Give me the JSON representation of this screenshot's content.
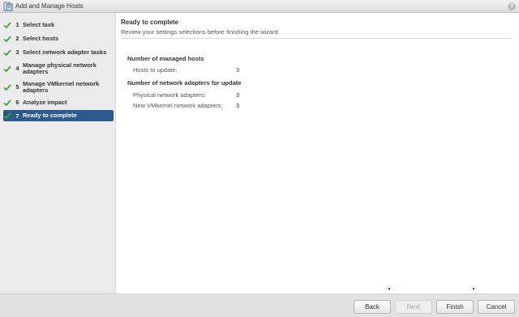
{
  "window": {
    "title": "Add and Manage Hosts",
    "help_glyph": "?"
  },
  "steps": [
    {
      "num": "1",
      "label": "Select task",
      "done": true,
      "active": false
    },
    {
      "num": "2",
      "label": "Select hosts",
      "done": true,
      "active": false
    },
    {
      "num": "3",
      "label": "Select network adapter tasks",
      "done": true,
      "active": false
    },
    {
      "num": "4",
      "label": "Manage physical network adapters",
      "done": true,
      "active": false
    },
    {
      "num": "5",
      "label": "Manage VMkernel network adapters",
      "done": true,
      "active": false
    },
    {
      "num": "6",
      "label": "Analyze impact",
      "done": true,
      "active": false
    },
    {
      "num": "7",
      "label": "Ready to complete",
      "done": true,
      "active": true
    }
  ],
  "content": {
    "title": "Ready to complete",
    "subtitle": "Review your settings selections before finishing the wizard.",
    "sections": [
      {
        "heading": "Number of managed hosts",
        "rows": [
          {
            "label": "Hosts to update:",
            "value": "3"
          }
        ]
      },
      {
        "heading": "Number of network adapters for update",
        "rows": [
          {
            "label": "Physical network adapters:",
            "value": "3"
          },
          {
            "label": "New VMkernel network adapters:",
            "value": "3"
          }
        ]
      }
    ]
  },
  "footer": {
    "back_label": "Back",
    "next_label": "Next",
    "finish_label": "Finish",
    "cancel_label": "Cancel"
  },
  "colors": {
    "accent": "#2d5a8c",
    "check": "#3aa53a",
    "sidebar_bg": "#ebebeb"
  },
  "icons": {
    "app": "hosts-wizard-icon",
    "step_done": "check-icon",
    "help": "help-icon"
  }
}
